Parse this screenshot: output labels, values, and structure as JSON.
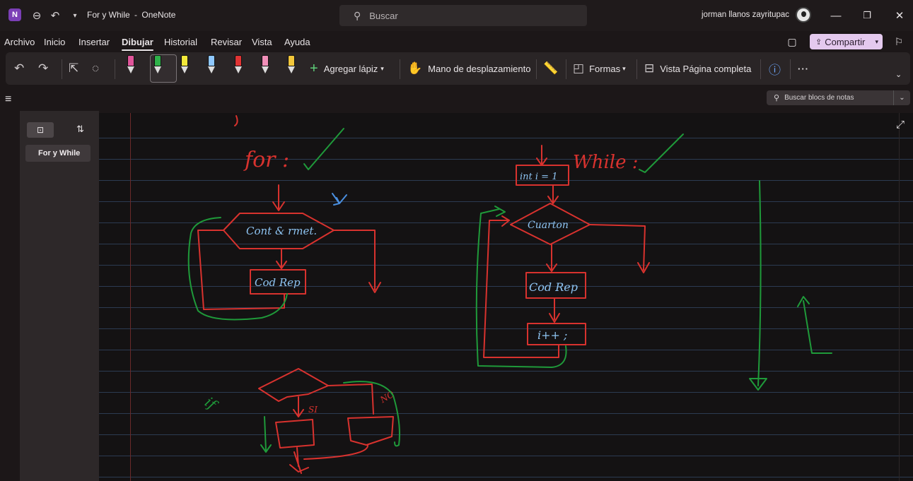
{
  "titlebar": {
    "document_title": "For y While",
    "app_name": "OneNote",
    "title_separator": "-",
    "search_placeholder": "Buscar",
    "user_name": "jorman llanos zayritupac"
  },
  "menu": {
    "items": [
      "Archivo",
      "Inicio",
      "Insertar",
      "Dibujar",
      "Historial",
      "Revisar",
      "Vista",
      "Ayuda"
    ],
    "active": "Dibujar",
    "share_label": "Compartir"
  },
  "ribbon": {
    "add_pen_label": "Agregar lápiz",
    "hand_label": "Mano de desplazamiento",
    "shapes_label": "Formas",
    "fullpage_label": "Vista Página completa",
    "more_label": "···",
    "pens": [
      {
        "color": "#e0559a"
      },
      {
        "color": "#2fb24a"
      },
      {
        "color": "#f2e83a"
      },
      {
        "color": "#8fc8ff"
      },
      {
        "color": "#e03434"
      },
      {
        "color": "#f08fb8"
      },
      {
        "color": "#f2c63a"
      }
    ]
  },
  "notebook_search_placeholder": "Buscar blocs de notas",
  "pages": [
    {
      "title": "For y While"
    }
  ],
  "ink_text": {
    "for_label": "for :",
    "while_label": "While :",
    "for_condition": "Cont & rmet.",
    "for_body": "Cod Rep",
    "while_init": "int i = 1",
    "while_condition": "Cuarton",
    "while_body": "Cod Rep",
    "while_increment": "i++ ;",
    "if_label": "if",
    "if_yes": "SI",
    "if_no": "NO"
  },
  "colors": {
    "ink_red": "#d8322e",
    "ink_green": "#1f9a3a",
    "ink_blue": "#8ec4f2",
    "accent": "#7b3fb6"
  }
}
